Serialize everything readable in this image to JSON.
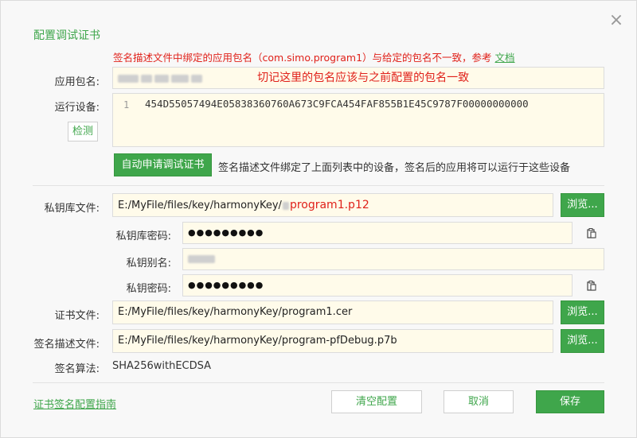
{
  "dialog": {
    "title": "配置调试证书",
    "close_icon": "×"
  },
  "warning": {
    "text": "签名描述文件中绑定的应用包名（com.simo.program1）与给定的包名不一致，参考",
    "link": "文档"
  },
  "app_package": {
    "label": "应用包名:",
    "note": "切记这里的包名应该与之前配置的包名一致"
  },
  "device": {
    "label": "运行设备:",
    "detect_button": "检测",
    "line_number": "1",
    "device_id": "454D55057494E05838360760A673C9FCA454FAF855B1E45C9787F00000000000",
    "auto_apply_button": "自动申请调试证书",
    "bind_note": "签名描述文件绑定了上面列表中的设备，签名后的应用将可以运行于这些设备"
  },
  "keystore": {
    "label": "私钥库文件:",
    "path_prefix": "E:/MyFile/files/key/harmonyKey/",
    "path_suffix": "program1.p12",
    "browse": "浏览..."
  },
  "keystore_password": {
    "label": "私钥库密码:",
    "value": "●●●●●●●●●"
  },
  "key_alias": {
    "label": "私钥别名:"
  },
  "key_password": {
    "label": "私钥密码:",
    "value": "●●●●●●●●●"
  },
  "certificate": {
    "label": "证书文件:",
    "path": "E:/MyFile/files/key/harmonyKey/program1.cer",
    "browse": "浏览..."
  },
  "profile": {
    "label": "签名描述文件:",
    "path": "E:/MyFile/files/key/harmonyKey/program-pfDebug.p7b",
    "browse": "浏览..."
  },
  "algorithm": {
    "label": "签名算法:",
    "value": "SHA256withECDSA"
  },
  "footer": {
    "guide_link": "证书签名配置指南",
    "clear_button": "清空配置",
    "cancel_button": "取消",
    "save_button": "保存"
  },
  "colors": {
    "accent": "#3fa64b",
    "warning": "#e0211a"
  }
}
